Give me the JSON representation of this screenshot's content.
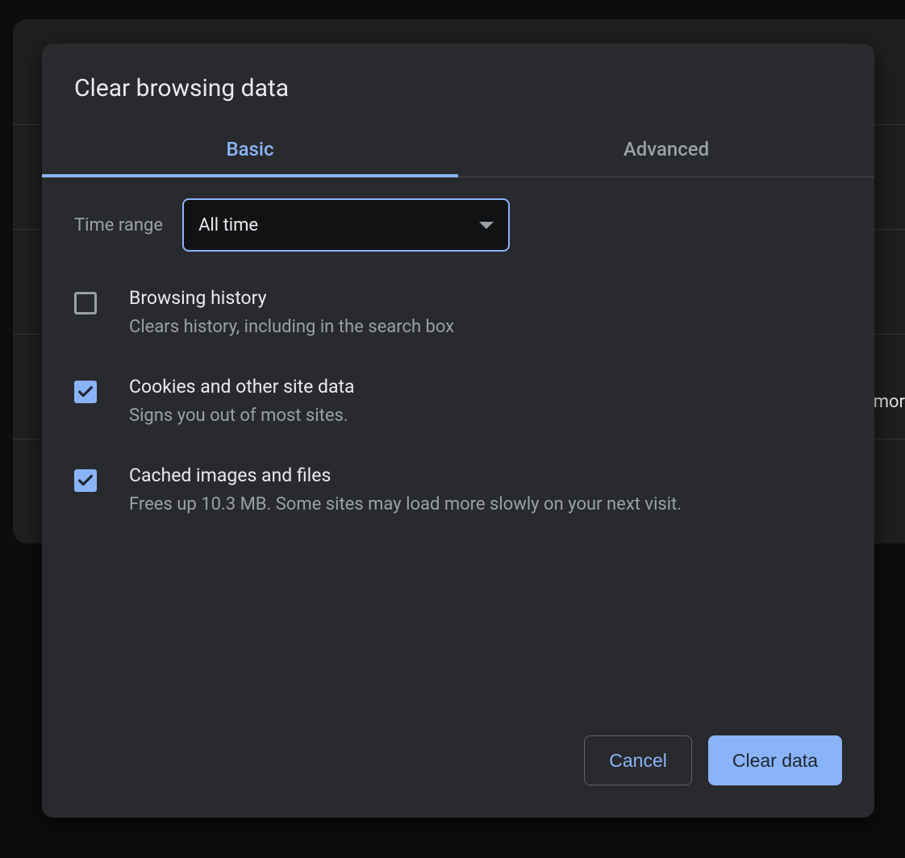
{
  "dialog": {
    "title": "Clear browsing data",
    "tabs": {
      "basic": "Basic",
      "advanced": "Advanced",
      "active": "basic"
    },
    "time_range": {
      "label": "Time range",
      "value": "All time"
    },
    "items": [
      {
        "title": "Browsing history",
        "desc": "Clears history, including in the search box",
        "checked": false
      },
      {
        "title": "Cookies and other site data",
        "desc": "Signs you out of most sites.",
        "checked": true
      },
      {
        "title": "Cached images and files",
        "desc": "Frees up 10.3 MB. Some sites may load more slowly on your next visit.",
        "checked": true
      }
    ],
    "buttons": {
      "cancel": "Cancel",
      "confirm": "Clear data"
    }
  },
  "background": {
    "partial_text": "mor"
  }
}
